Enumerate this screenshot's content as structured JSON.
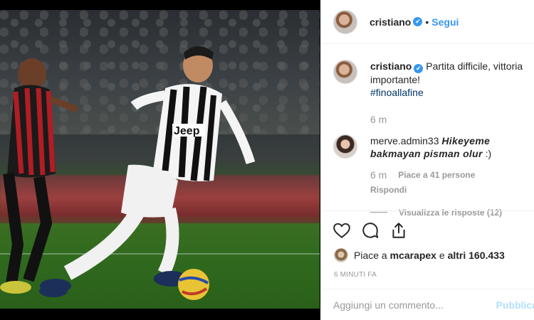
{
  "post": {
    "author": "cristiano",
    "follow_label": "Segui",
    "separator": "•",
    "verified_mark": "✔"
  },
  "caption": {
    "author": "cristiano",
    "text": "Partita difficile, vittoria importante!",
    "hashtag": "#finoallafine",
    "time": "6 m"
  },
  "comment": {
    "author": "merve.admin33",
    "text_bold": "Hikeyeme bakmayan pisman olur",
    "text_tail": ":)",
    "time": "6 m",
    "likes": "Piace a 41 persone",
    "reply_label": "Rispondi",
    "view_replies": "Visualizza le risposte (12)"
  },
  "actions": {
    "icons": [
      "heart-icon",
      "comment-icon",
      "share-icon"
    ]
  },
  "likes": {
    "prefix": "Piace a",
    "user": "mcarapex",
    "conj": "e",
    "others": "altri 160.433"
  },
  "timestamp": "6 MINUTI FA",
  "composer": {
    "placeholder": "Aggiungi un commento...",
    "publish_label": "Pubblica"
  },
  "colors": {
    "accent": "#3897f0",
    "hashtag": "#003569",
    "muted": "#999999",
    "border": "#efefef"
  }
}
